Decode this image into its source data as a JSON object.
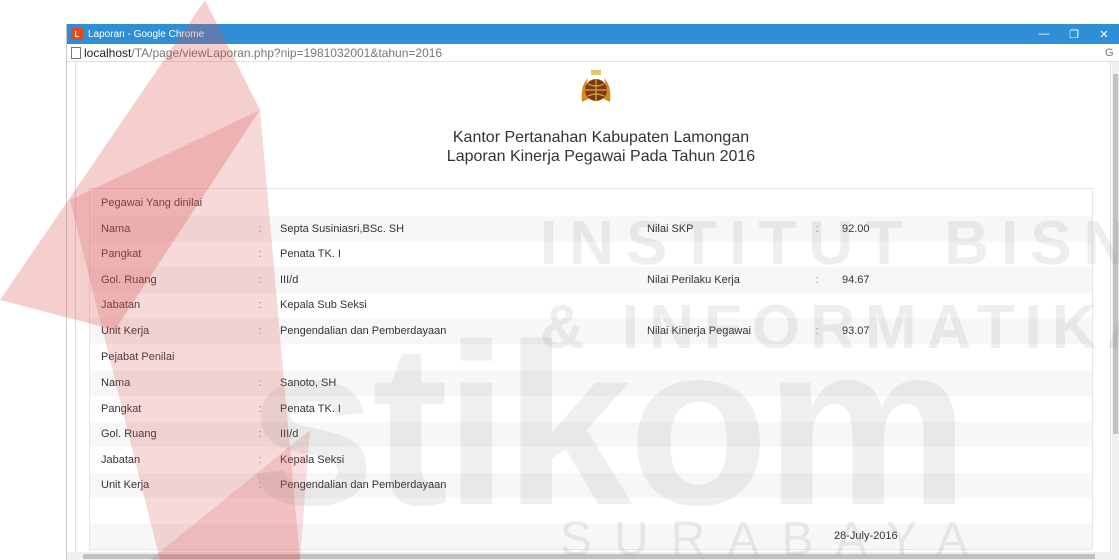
{
  "window": {
    "title": "Laporan - Google Chrome",
    "url_host": "localhost",
    "url_path": "/TA/page/viewLaporan.php?nip=1981032001&tahun=2016"
  },
  "header": {
    "office": "Kantor Pertanahan Kabupaten Lamongan",
    "report_title": "Laporan Kinerja Pegawai Pada Tahun 2016"
  },
  "section_pegawai": {
    "title": "Pegawai Yang dinilai",
    "rows": [
      {
        "label": "Nama",
        "value": "Septa Susiniasri,BSc. SH",
        "label2": "Nilai SKP",
        "value2": "92.00"
      },
      {
        "label": "Pangkat",
        "value": "Penata TK. I",
        "label2": "",
        "value2": ""
      },
      {
        "label": "Gol. Ruang",
        "value": "III/d",
        "label2": "Nilai Perilaku Kerja",
        "value2": "94.67"
      },
      {
        "label": "Jabatan",
        "value": "Kepala Sub Seksi",
        "label2": "",
        "value2": ""
      },
      {
        "label": "Unit Kerja",
        "value": "Pengendalian dan Pemberdayaan",
        "label2": "Nilai Kinerja Pegawai",
        "value2": "93.07"
      }
    ]
  },
  "section_penilai": {
    "title": "Pejabat Penilai",
    "rows": [
      {
        "label": "Nama",
        "value": "Sanoto, SH"
      },
      {
        "label": "Pangkat",
        "value": "Penata TK. I"
      },
      {
        "label": "Gol. Ruang",
        "value": "III/d"
      },
      {
        "label": "Jabatan",
        "value": "Kepala Seksi"
      },
      {
        "label": "Unit Kerja",
        "value": "Pengendalian dan Pemberdayaan"
      }
    ]
  },
  "colon": ":",
  "date": "28-July-2016",
  "watermark": {
    "line1": "INSTITUT BISNIS",
    "line2": "& INFORMATIKA",
    "brand": "stikom",
    "city": "SURABAYA"
  },
  "colors": {
    "titlebar": "#2f8fd6",
    "watermark_red": "#e8a0a0"
  },
  "icons": [
    "chrome-app-icon",
    "minimize-icon",
    "restore-icon",
    "close-icon",
    "page-icon",
    "logo-emblem"
  ]
}
